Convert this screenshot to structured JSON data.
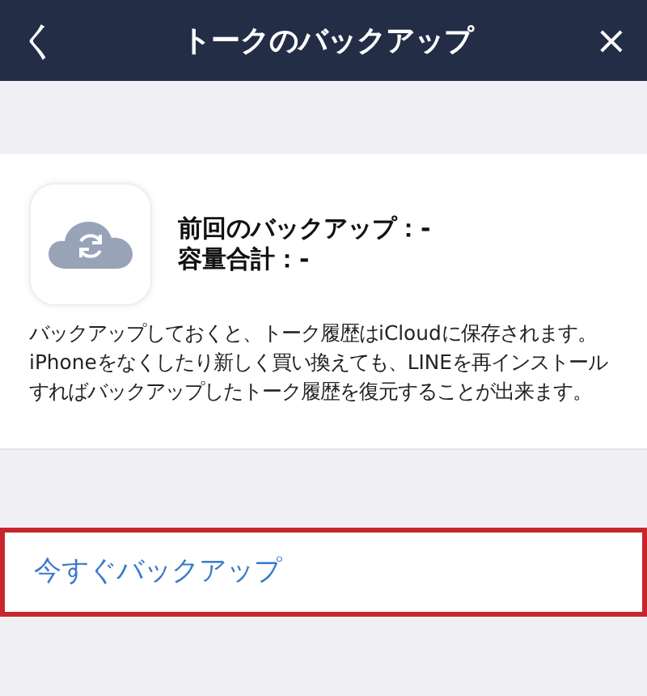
{
  "header": {
    "back": "く",
    "title": "トークのバックアップ",
    "close": "×"
  },
  "backup_info": {
    "last_backup": "前回のバックアップ：-",
    "total_size": "容量合計：-"
  },
  "description": [
    "バックアップしておくと、トーク履歴はiCloudに保存されます。",
    "iPhoneをなくしたり新しく買い換えても、LINEを再インストールすればバックアップしたトーク履歴を復元することが出来ます。"
  ],
  "action": {
    "label": "今すぐバックアップ",
    "highlighted": true
  }
}
